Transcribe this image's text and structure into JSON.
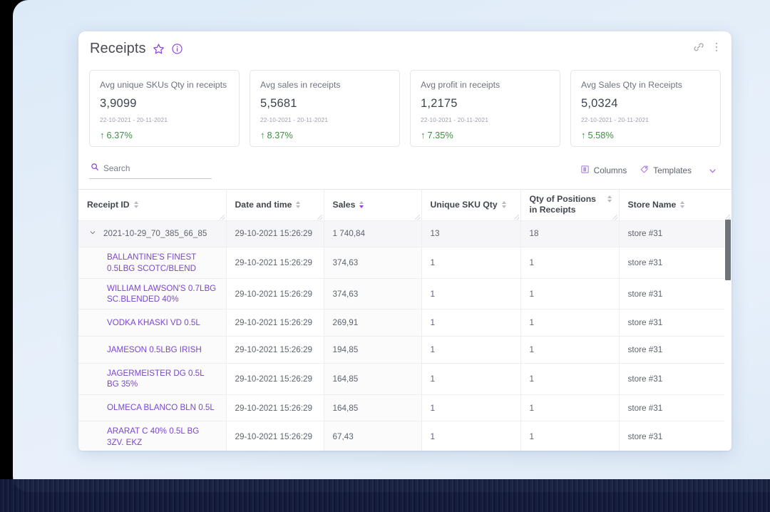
{
  "header": {
    "title": "Receipts",
    "favorite_icon": "star-icon",
    "info_icon": "info-icon",
    "link_icon": "link-icon",
    "more_icon": "more-vertical-icon",
    "accent_color": "#8b3fd6"
  },
  "kpis": [
    {
      "label": "Avg unique SKUs Qty in receipts",
      "value": "3,9099",
      "range": "22-10-2021 - 20-11-2021",
      "delta": "6.37%",
      "delta_arrow": "↑",
      "delta_color": "#3f8f46"
    },
    {
      "label": "Avg sales in receipts",
      "value": "5,5681",
      "range": "22-10-2021 - 20-11-2021",
      "delta": "8.37%",
      "delta_arrow": "↑",
      "delta_color": "#3f8f46"
    },
    {
      "label": "Avg profit in receipts",
      "value": "1,2175",
      "range": "22-10-2021 - 20-11-2021",
      "delta": "7.35%",
      "delta_arrow": "↑",
      "delta_color": "#3f8f46"
    },
    {
      "label": "Avg Sales Qty in Receipts",
      "value": "5,0324",
      "range": "22-10-2021 - 20-11-2021",
      "delta": "5.58%",
      "delta_arrow": "↑",
      "delta_color": "#3f8f46"
    }
  ],
  "toolbar": {
    "search_placeholder": "Search",
    "search_value": "",
    "search_icon": "search-icon",
    "columns_label": "Columns",
    "columns_icon": "columns-icon",
    "templates_label": "Templates",
    "templates_icon": "tag-icon",
    "expand_icon": "chevron-down-icon"
  },
  "table": {
    "columns": [
      {
        "label": "Receipt ID",
        "sort": "none"
      },
      {
        "label": "Date and time",
        "sort": "none"
      },
      {
        "label": "Sales",
        "sort": "desc"
      },
      {
        "label": "Unique SKU Qty",
        "sort": "none"
      },
      {
        "label": "Qty of Positions in Receipts",
        "sort": "none"
      },
      {
        "label": "Store Name",
        "sort": "none"
      }
    ],
    "group_row": {
      "expanded": true,
      "chevron_icon": "chevron-down-icon",
      "receipt_id": "2021-10-29_70_385_66_85",
      "date": "29-10-2021 15:26:29",
      "sales": "1 740,84",
      "unique_sku": "13",
      "positions": "18",
      "store": "store #31"
    },
    "rows": [
      {
        "product": "BALLANTINE'S FINEST 0.5LBG SCOTC/BLEND",
        "date": "29-10-2021 15:26:29",
        "sales": "374,63",
        "unique_sku": "1",
        "positions": "1",
        "store": "store #31"
      },
      {
        "product": "WILLIAM LAWSON'S 0.7LBG SC.BLENDED 40%",
        "date": "29-10-2021 15:26:29",
        "sales": "374,63",
        "unique_sku": "1",
        "positions": "1",
        "store": "store #31"
      },
      {
        "product": "VODKA KHASKI VD 0.5L",
        "date": "29-10-2021 15:26:29",
        "sales": "269,91",
        "unique_sku": "1",
        "positions": "1",
        "store": "store #31"
      },
      {
        "product": "JAMESON 0.5LBG IRISH",
        "date": "29-10-2021 15:26:29",
        "sales": "194,85",
        "unique_sku": "1",
        "positions": "1",
        "store": "store #31"
      },
      {
        "product": "JAGERMEISTER DG 0.5L BG 35%",
        "date": "29-10-2021 15:26:29",
        "sales": "164,85",
        "unique_sku": "1",
        "positions": "1",
        "store": "store #31"
      },
      {
        "product": "OLMECA BLANCO BLN 0.5L",
        "date": "29-10-2021 15:26:29",
        "sales": "164,85",
        "unique_sku": "1",
        "positions": "1",
        "store": "store #31"
      },
      {
        "product": "ARARAT C 40% 0.5L BG 3ZV. EKZ",
        "date": "29-10-2021 15:26:29",
        "sales": "67,43",
        "unique_sku": "1",
        "positions": "1",
        "store": "store #31"
      }
    ]
  }
}
